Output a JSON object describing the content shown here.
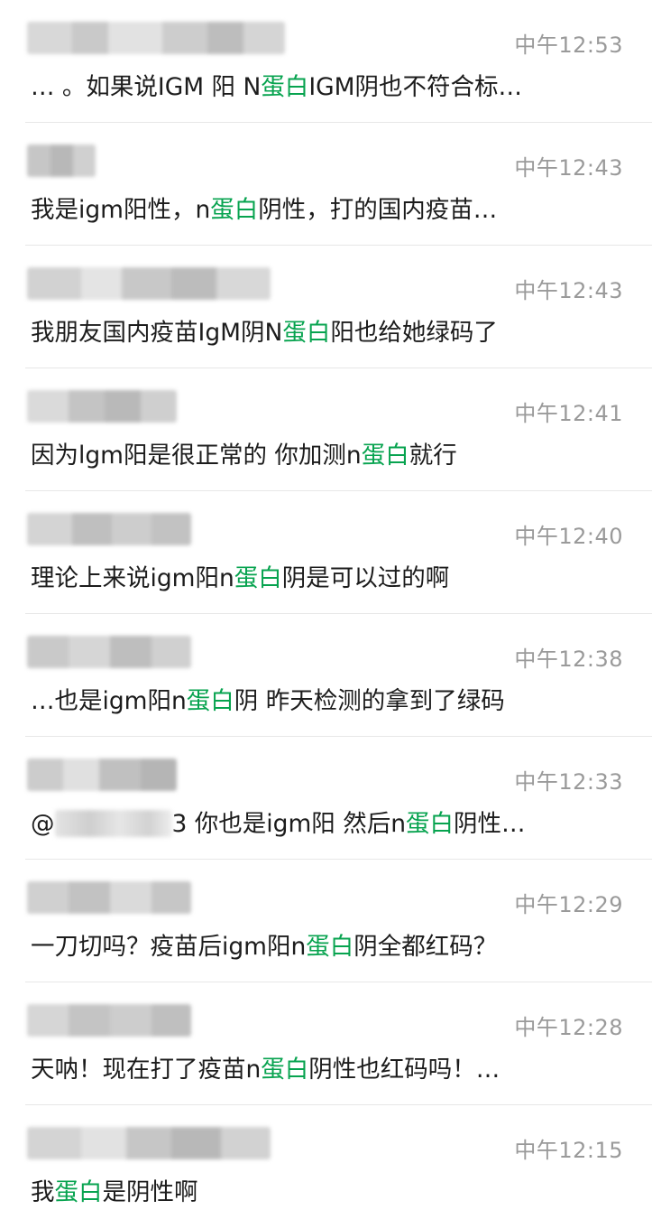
{
  "highlight_color": "#07a34f",
  "messages": [
    {
      "time": "中午12:53",
      "segments": [
        "… 。如果说IGM 阳 N",
        "蛋白",
        "IGM阴也不符合标…"
      ]
    },
    {
      "time": "中午12:43",
      "segments": [
        "我是igm阳性，n",
        "蛋白",
        "阴性，打的国内疫苗…"
      ]
    },
    {
      "time": "中午12:43",
      "segments": [
        "我朋友国内疫苗IgM阴N",
        "蛋白",
        "阳也给她绿码了"
      ]
    },
    {
      "time": "中午12:41",
      "segments": [
        "因为lgm阳是很正常的 你加测n",
        "蛋白",
        "就行"
      ]
    },
    {
      "time": "中午12:40",
      "segments": [
        "理论上来说igm阳n",
        "蛋白",
        "阴是可以过的啊"
      ]
    },
    {
      "time": "中午12:38",
      "segments": [
        "…也是igm阳n",
        "蛋白",
        "阴 昨天检测的拿到了绿码"
      ]
    },
    {
      "time": "中午12:33",
      "segments": [
        "@",
        "3 你也是igm阳  然后n",
        "蛋白",
        "阴性…"
      ]
    },
    {
      "time": "中午12:29",
      "segments": [
        "一刀切吗？疫苗后igm阳n",
        "蛋白",
        "阴全都红码？"
      ]
    },
    {
      "time": "中午12:28",
      "segments": [
        "天呐！现在打了疫苗n",
        "蛋白",
        "阴性也红码吗！…"
      ]
    },
    {
      "time": "中午12:15",
      "segments": [
        "我",
        "蛋白",
        "是阴性啊"
      ]
    }
  ]
}
